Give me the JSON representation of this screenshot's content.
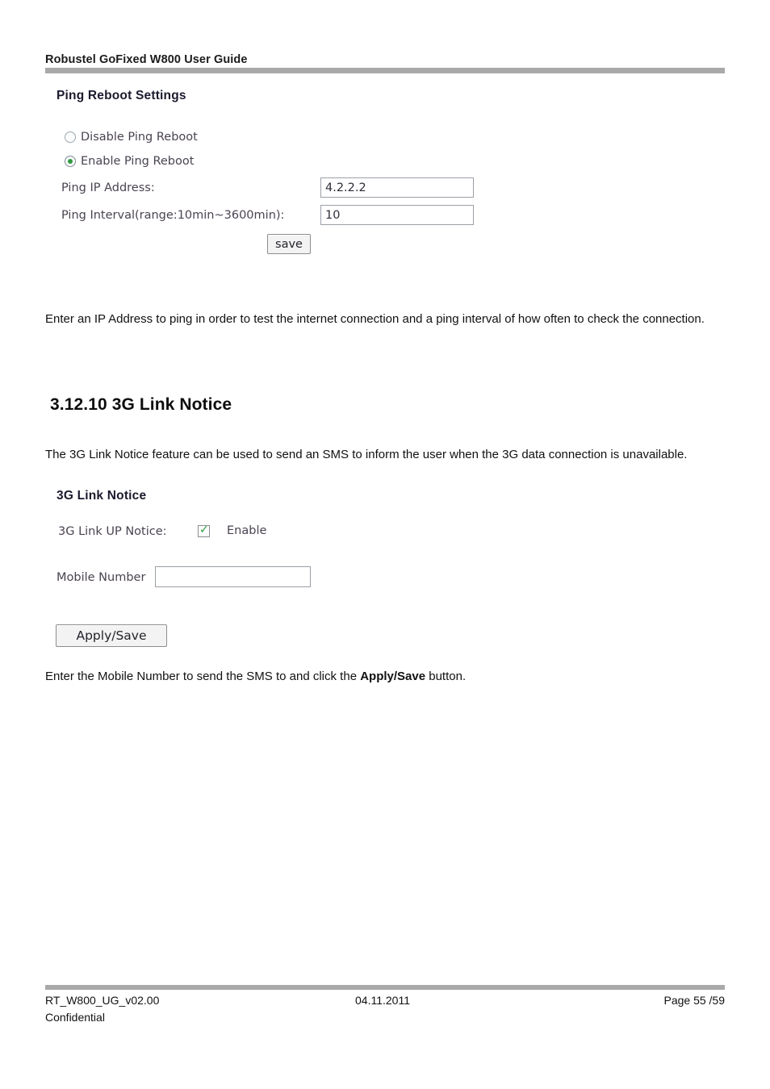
{
  "document": {
    "header": "Robustel GoFixed W800 User Guide",
    "heading": "3.12.10 3G Link Notice",
    "paragraph_1": "Enter an IP Address to ping in order to test the internet connection and a ping interval of how often to check the connection.",
    "paragraph_2": "The 3G Link Notice feature can be used to send an SMS to inform the user when the 3G data connection is unavailable.",
    "paragraph_3_before": "Enter the Mobile Number to send the SMS to and click the ",
    "paragraph_3_bold": "Apply/Save",
    "paragraph_3_after": " button."
  },
  "ping_reboot_panel": {
    "title": "Ping Reboot Settings",
    "radio_disable_label": "Disable Ping Reboot",
    "radio_enable_label": "Enable Ping Reboot",
    "radio_selected": "Enable Ping Reboot",
    "ip_label": "Ping IP Address:",
    "ip_value": "4.2.2.2",
    "interval_label": "Ping Interval(range:10min~3600min):",
    "interval_value": "10",
    "save_button": "save"
  },
  "link_notice_panel": {
    "title": "3G Link Notice",
    "notice_label": "3G Link UP Notice:",
    "enable_label": "Enable",
    "enable_checked": true,
    "mobile_label": "Mobile Number",
    "mobile_value": "",
    "apply_button": "Apply/Save"
  },
  "footer": {
    "doc_id": "RT_W800_UG_v02.00",
    "date": "04.11.2011",
    "page": "Page 55 /59",
    "classification": "Confidential"
  },
  "colors": {
    "rule_gray": "#a9a9a9",
    "control_green": "#2e9b3f",
    "label_purple": "#4a4350"
  }
}
